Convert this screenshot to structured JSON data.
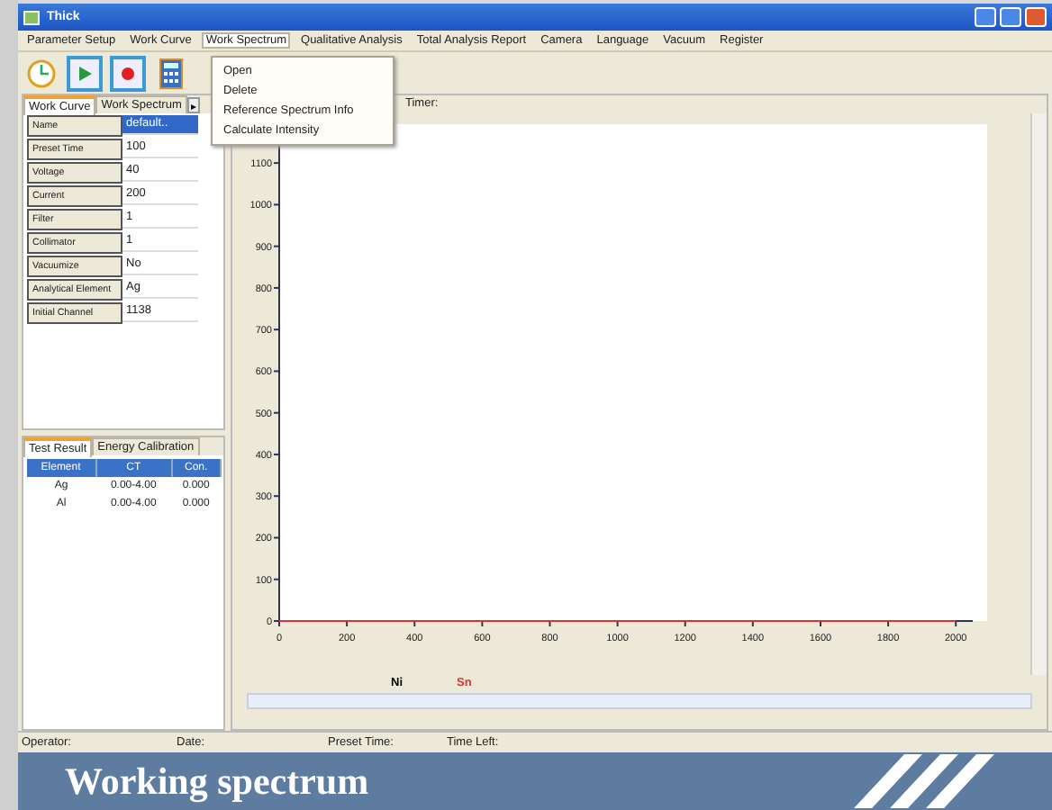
{
  "window": {
    "title": "Thick"
  },
  "menu": [
    {
      "label": "Parameter Setup",
      "selected": false
    },
    {
      "label": "Work Curve",
      "selected": false
    },
    {
      "label": "Work Spectrum",
      "selected": true
    },
    {
      "label": "Qualitative Analysis",
      "selected": false
    },
    {
      "label": "Total Analysis Report",
      "selected": false
    },
    {
      "label": "Camera",
      "selected": false
    },
    {
      "label": "Language",
      "selected": false
    },
    {
      "label": "Vacuum",
      "selected": false
    },
    {
      "label": "Register",
      "selected": false
    }
  ],
  "dropdown": [
    "Open",
    "Delete",
    "Reference Spectrum Info",
    "Calculate Intensity"
  ],
  "chart_caption": "Timer:",
  "left_tabs": [
    {
      "label": "Work Curve",
      "selected": true
    },
    {
      "label": "Work Spectrum",
      "selected": false
    }
  ],
  "tab_scroll": "▸",
  "params": [
    {
      "name": "Name",
      "value": "default..",
      "selected": true
    },
    {
      "name": "Preset Time",
      "value": "100",
      "selected": false
    },
    {
      "name": "Voltage",
      "value": "40",
      "selected": false
    },
    {
      "name": "Current",
      "value": "200",
      "selected": false
    },
    {
      "name": "Filter",
      "value": "1",
      "selected": false
    },
    {
      "name": "Collimator",
      "value": "1",
      "selected": false
    },
    {
      "name": "Vacuumize",
      "value": "No",
      "selected": false
    },
    {
      "name": "Analytical Element",
      "value": "Ag",
      "selected": false
    },
    {
      "name": "Initial Channel",
      "value": "1138",
      "selected": false
    }
  ],
  "result_tabs": [
    {
      "label": "Test Result",
      "selected": true
    },
    {
      "label": "Energy Calibration",
      "selected": false
    }
  ],
  "results": {
    "columns": [
      "Element",
      "CT",
      "Con."
    ],
    "rows": [
      [
        "Ag",
        "0.00-4.00",
        "0.000"
      ],
      [
        "Al",
        "0.00-4.00",
        "0.000"
      ]
    ]
  },
  "chart": {
    "chart_data": {
      "type": "line",
      "x": [
        0,
        2000
      ],
      "series": [
        {
          "name": "Sn",
          "color": "#e03030",
          "values": [
            0,
            0
          ]
        }
      ],
      "xlim": [
        0,
        2050
      ],
      "ylim": [
        0,
        1150
      ],
      "xticks": [
        0,
        200,
        400,
        600,
        800,
        1000,
        1200,
        1400,
        1600,
        1800,
        2000
      ],
      "yticks": [
        0,
        100,
        200,
        300,
        400,
        500,
        600,
        700,
        800,
        900,
        1000,
        1100
      ]
    }
  },
  "legend": [
    {
      "label": "Ni",
      "color": "#000000"
    }
  ],
  "status_bar": [
    "Operator:",
    "Date:",
    "Preset Time:",
    "Time Left:"
  ],
  "banner": "Working spectrum"
}
